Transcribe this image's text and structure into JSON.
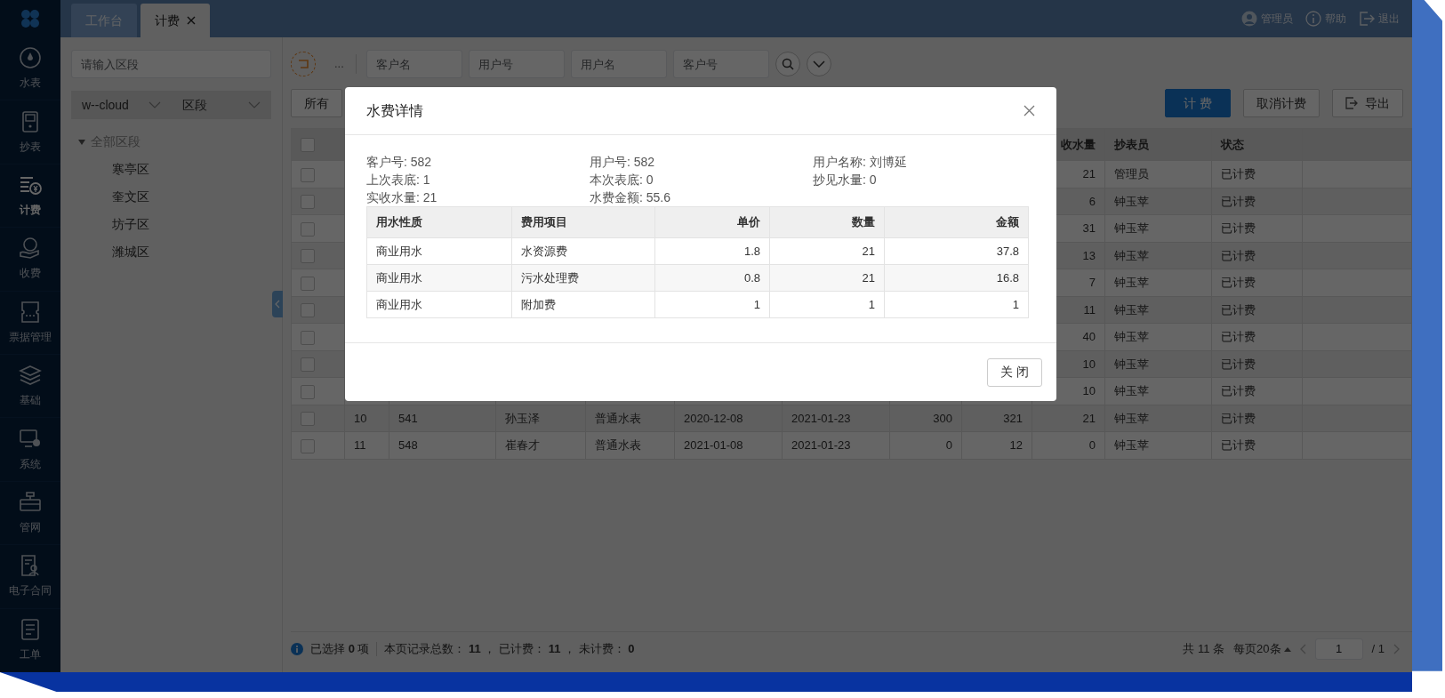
{
  "sidebar": {
    "items": [
      {
        "kind": "meter",
        "label": "水表",
        "selected": false
      },
      {
        "kind": "reader",
        "label": "抄表",
        "selected": false
      },
      {
        "kind": "billing",
        "label": "计费",
        "selected": true
      },
      {
        "kind": "payment",
        "label": "收费",
        "selected": false
      },
      {
        "kind": "ticket",
        "label": "票据管理",
        "selected": false
      },
      {
        "kind": "layers",
        "label": "基础",
        "selected": false
      },
      {
        "kind": "system",
        "label": "系统",
        "selected": false
      },
      {
        "kind": "pipe",
        "label": "管网",
        "selected": false
      },
      {
        "kind": "contract",
        "label": "电子合同",
        "selected": false
      },
      {
        "kind": "order",
        "label": "工单",
        "selected": false
      }
    ]
  },
  "tabs": [
    {
      "label": "工作台",
      "selected": false,
      "closable": false
    },
    {
      "label": "计费",
      "selected": true,
      "closable": true
    }
  ],
  "header_actions": [
    {
      "kind": "user",
      "label": "管理员"
    },
    {
      "kind": "help",
      "label": "帮助"
    },
    {
      "kind": "logout",
      "label": "退出"
    }
  ],
  "region_panel": {
    "search": {
      "placeholder": "请输入区段"
    },
    "selects": [
      {
        "value": "w--cloud"
      },
      {
        "value": "区段"
      }
    ],
    "tree": [
      {
        "label": "全部区段",
        "expanded": true,
        "children": [
          {
            "label": "寒亭区"
          },
          {
            "label": "奎文区"
          },
          {
            "label": "坊子区"
          },
          {
            "label": "潍城区"
          }
        ]
      }
    ]
  },
  "filters": {
    "more": "...",
    "fields": [
      {
        "placeholder": "客户名"
      },
      {
        "placeholder": "用户号"
      },
      {
        "placeholder": "用户名"
      },
      {
        "placeholder": "客户号"
      }
    ]
  },
  "toolbar": {
    "filter_button": "所有",
    "buttons": [
      {
        "kind": "primary",
        "label": "计 费"
      },
      {
        "kind": "default",
        "label": "取消计费"
      },
      {
        "kind": "export",
        "label": "导出"
      }
    ]
  },
  "table": {
    "select_all": {
      "checked": false
    },
    "columns": [
      null,
      null,
      null,
      null,
      null,
      null,
      null,
      null,
      "收水量",
      "抄表员",
      "状态"
    ],
    "rows": [
      {
        "checked": false,
        "cells": [
          null,
          null,
          null,
          null,
          null,
          null,
          null,
          null,
          "21",
          "管理员",
          "已计费"
        ]
      },
      {
        "checked": false,
        "cells": [
          null,
          null,
          null,
          null,
          null,
          null,
          null,
          null,
          "6",
          "钟玉苹",
          "已计费"
        ]
      },
      {
        "checked": false,
        "cells": [
          null,
          null,
          null,
          null,
          null,
          null,
          null,
          null,
          "31",
          "钟玉苹",
          "已计费"
        ]
      },
      {
        "checked": false,
        "cells": [
          null,
          null,
          null,
          null,
          null,
          null,
          null,
          null,
          "13",
          "钟玉苹",
          "已计费"
        ]
      },
      {
        "checked": false,
        "cells": [
          null,
          null,
          null,
          null,
          null,
          null,
          null,
          null,
          "7",
          "钟玉苹",
          "已计费"
        ]
      },
      {
        "checked": false,
        "cells": [
          null,
          null,
          null,
          null,
          null,
          null,
          null,
          null,
          "11",
          "钟玉苹",
          "已计费"
        ]
      },
      {
        "checked": false,
        "cells": [
          null,
          null,
          null,
          null,
          null,
          null,
          null,
          null,
          "40",
          "钟玉苹",
          "已计费"
        ]
      },
      {
        "checked": false,
        "cells": [
          null,
          null,
          null,
          null,
          null,
          null,
          null,
          null,
          "10",
          "钟玉苹",
          "已计费"
        ]
      },
      {
        "checked": false,
        "cells": [
          null,
          null,
          null,
          null,
          null,
          null,
          null,
          null,
          "10",
          "钟玉苹",
          "已计费"
        ]
      },
      {
        "checked": false,
        "cells": [
          "10",
          "541",
          "孙玉泽",
          "普通水表",
          "2020-12-08",
          "2021-01-23",
          "300",
          "321",
          "21",
          "钟玉苹",
          "已计费"
        ]
      },
      {
        "checked": false,
        "cells": [
          "11",
          "548",
          "崔春才",
          "普通水表",
          "2021-01-08",
          "2021-01-23",
          "0",
          "12",
          "0",
          "钟玉苹",
          "已计费"
        ]
      }
    ]
  },
  "footer": {
    "selection": "已选择 **0** 项",
    "summary": "本页记录总数： **11** ， 已计费： **11** ， 未计费： **0**",
    "total": "共 11 条",
    "page_size": "每页20条",
    "page": "1",
    "page_count": "/ 1"
  },
  "modal": {
    "title": "水费详情",
    "fields": [
      "客户号: 582",
      "用户号: 582",
      "用户名称: 刘博延",
      "上次表底: 1",
      "本次表底: 0",
      "抄见水量: 0",
      "实收水量: 21",
      "水费金额: 55.6"
    ],
    "table": {
      "columns": [
        "用水性质",
        "费用项目",
        "单价",
        "数量",
        "金额"
      ],
      "rows": [
        [
          "商业用水",
          "水资源费",
          "1.8",
          "21",
          "37.8"
        ],
        [
          "商业用水",
          "污水处理费",
          "0.8",
          "21",
          "16.8"
        ],
        [
          "商业用水",
          "附加费",
          "1",
          "1",
          "1"
        ]
      ]
    },
    "buttons": [
      "关 闭"
    ]
  }
}
